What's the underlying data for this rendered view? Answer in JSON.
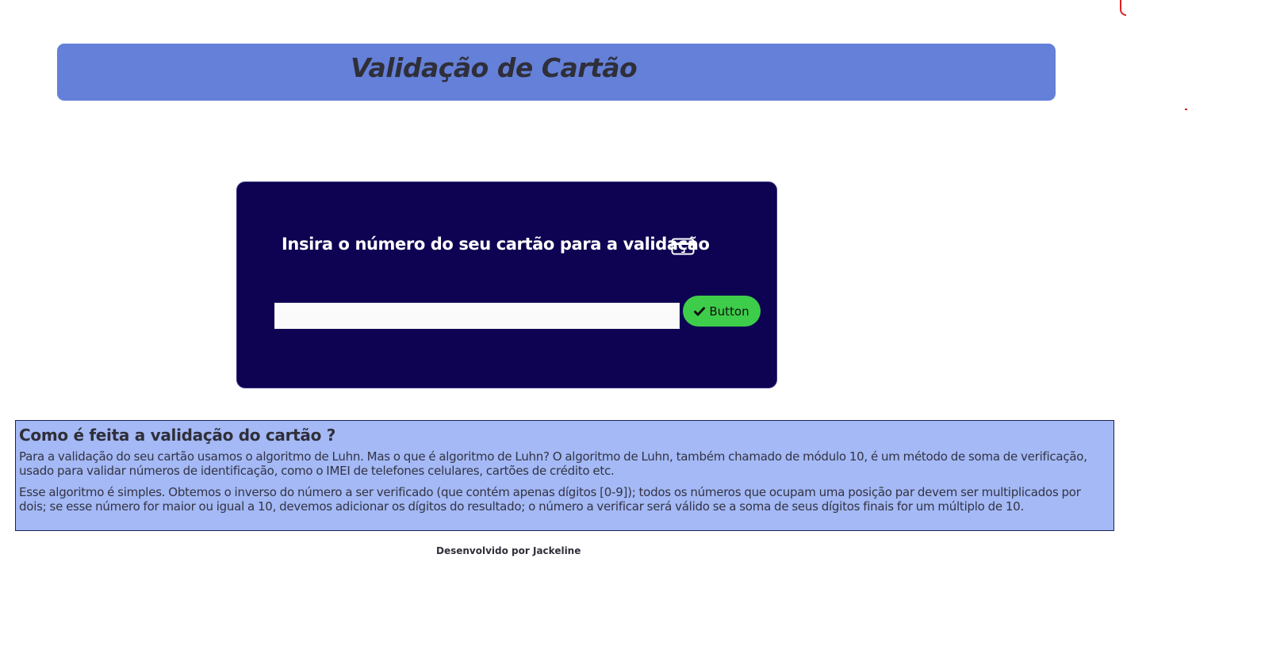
{
  "header": {
    "title": "Validação de Cartão"
  },
  "card_form": {
    "prompt": "Insira o número do seu cartão para a validação",
    "icon": "credit-card-icon",
    "input_value": "",
    "input_placeholder": "",
    "button_label": "Button",
    "button_icon": "check-icon"
  },
  "info": {
    "title": "Como é feita a validação do cartão ?",
    "paragraph_1": " Para a validação do seu cartão usamos o algoritmo de Luhn. Mas o que é algoritmo de Luhn? O algoritmo de Luhn, também chamado de módulo 10, é um método de soma de verificação, usado para validar números de identificação, como o IMEI de telefones celulares, cartões de crédito etc.",
    "paragraph_2": "Esse algoritmo é simples. Obtemos o inverso do número a ser verificado (que contém apenas dígitos [0-9]); todos os números que ocupam uma posição par devem ser multiplicados por dois; se esse número for maior ou igual a 10, devemos adicionar os dígitos do resultado; o número a verificar será válido se a soma de seus dígitos finais for um múltiplo de 10."
  },
  "footer": {
    "text": "Desenvolvido por Jackeline"
  },
  "colors": {
    "header_bg": "#6480d8",
    "panel_bg": "#0e0352",
    "button_bg": "#3ecd4a",
    "info_bg": "#a4b9f5"
  }
}
